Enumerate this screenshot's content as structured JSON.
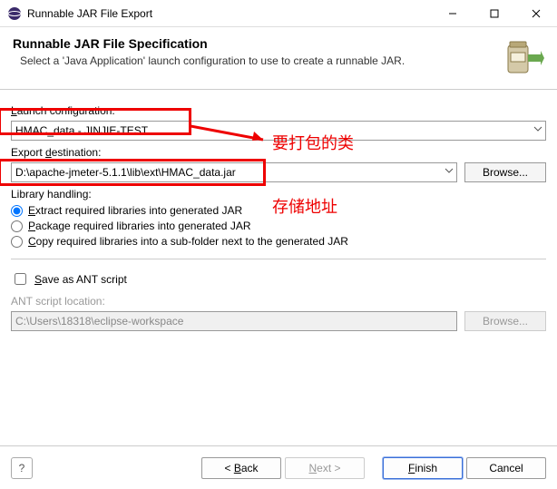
{
  "window": {
    "title": "Runnable JAR File Export"
  },
  "header": {
    "title": "Runnable JAR File Specification",
    "subtitle": "Select a 'Java Application' launch configuration to use to create a runnable JAR."
  },
  "launch": {
    "label": "Launch configuration:",
    "value": "HMAC_data - JINJIE-TEST"
  },
  "export": {
    "label": "Export destination:",
    "value": "D:\\apache-jmeter-5.1.1\\lib\\ext\\HMAC_data.jar",
    "browse": "Browse..."
  },
  "library": {
    "label": "Library handling:",
    "opt1": "Extract required libraries into generated JAR",
    "opt2": "Package required libraries into generated JAR",
    "opt3": "Copy required libraries into a sub-folder next to the generated JAR"
  },
  "ant": {
    "check": "Save as ANT script",
    "label": "ANT script location:",
    "value": "C:\\Users\\18318\\eclipse-workspace",
    "browse": "Browse..."
  },
  "footer": {
    "back": "< Back",
    "next": "Next >",
    "finish": "Finish",
    "cancel": "Cancel"
  },
  "annotations": {
    "a1": "要打包的类",
    "a2": "存储地址"
  }
}
